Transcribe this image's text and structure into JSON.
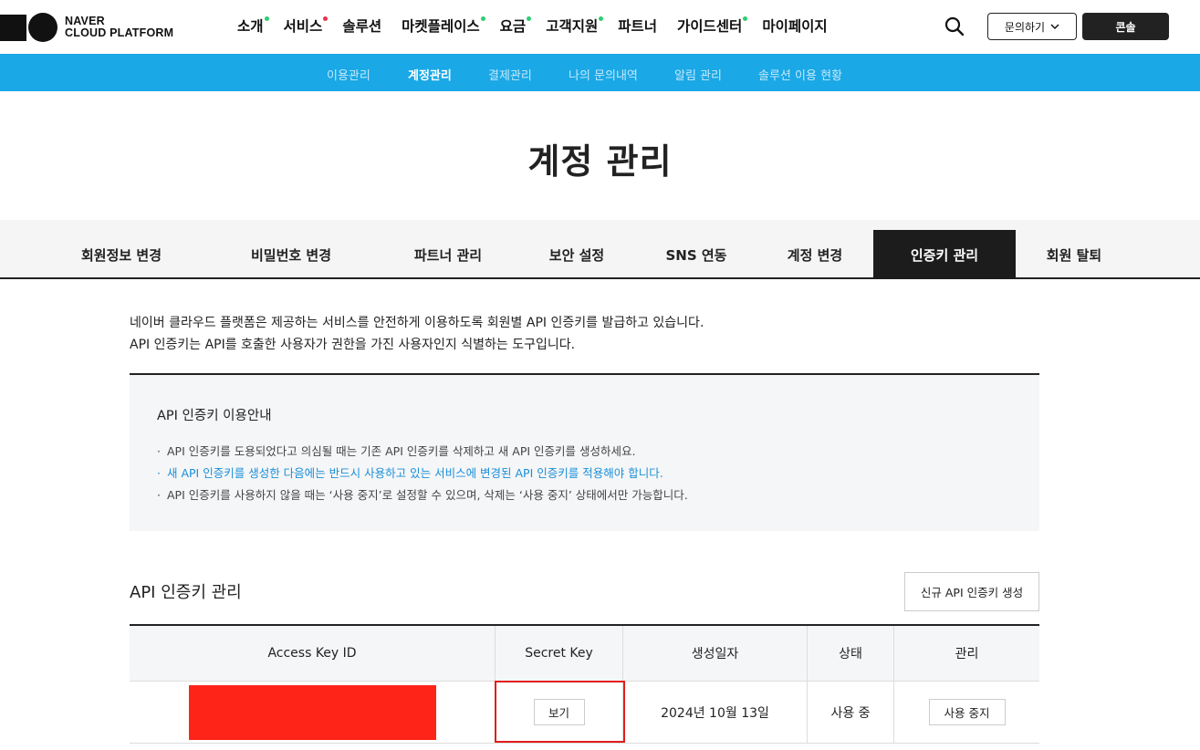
{
  "header": {
    "logo_line1": "NAVER",
    "logo_line2": "CLOUD PLATFORM",
    "gnb": [
      {
        "label": "소개",
        "dot": "#2ecc71"
      },
      {
        "label": "서비스",
        "dot": "#e8344d"
      },
      {
        "label": "솔루션",
        "dot": ""
      },
      {
        "label": "마켓플레이스",
        "dot": "#2ecc71"
      },
      {
        "label": "요금",
        "dot": "#2ecc71"
      },
      {
        "label": "고객지원",
        "dot": "#2ecc71"
      },
      {
        "label": "파트너",
        "dot": ""
      },
      {
        "label": "가이드센터",
        "dot": "#2ecc71"
      },
      {
        "label": "마이페이지",
        "dot": ""
      }
    ],
    "search_icon": "search-icon",
    "inquiry_label": "문의하기",
    "console_label": "콘솔"
  },
  "subnav": {
    "items": [
      "이용관리",
      "계정관리",
      "결제관리",
      "나의 문의내역",
      "알림 관리",
      "솔루션 이용 현황"
    ],
    "active_index": 1,
    "bg_color": "#1aa8e6"
  },
  "page_title": "계정 관리",
  "tabs": {
    "items": [
      "회원정보 변경",
      "비밀번호 변경",
      "파트너 관리",
      "보안 설정",
      "SNS 연동",
      "계정 변경",
      "인증키 관리",
      "회원 탈퇴"
    ],
    "active_index": 6
  },
  "intro": {
    "line1": "네이버 클라우드 플랫폼은 제공하는 서비스를 안전하게 이용하도록 회원별 API 인증키를 발급하고 있습니다.",
    "line2": "API 인증키는 API를 호출한 사용자가 권한을 가진 사용자인지 식별하는 도구입니다."
  },
  "guide": {
    "title": "API 인증키 이용안내",
    "items": [
      "API 인증키를 도용되었다고 의심될 때는 기존 API 인증키를 삭제하고 새 API 인증키를 생성하세요.",
      "새 API 인증키를 생성한 다음에는 반드시 사용하고 있는 서비스에 변경된 API 인증키를 적용해야 합니다.",
      "API 인증키를 사용하지 않을 때는 ‘사용 중지’로 설정할 수 있으며, 삭제는 ‘사용 중지’ 상태에서만 가능합니다."
    ]
  },
  "api_section": {
    "title": "API 인증키 관리",
    "create_label": "신규 API 인증키 생성"
  },
  "table": {
    "headers": [
      "Access Key ID",
      "Secret Key",
      "생성일자",
      "상태",
      "관리"
    ],
    "rows": [
      {
        "access_key": "",
        "secret_button": "보기",
        "created": "2024년 10월 13일",
        "status": "사용 중",
        "manage_button": "사용 중지"
      }
    ]
  }
}
